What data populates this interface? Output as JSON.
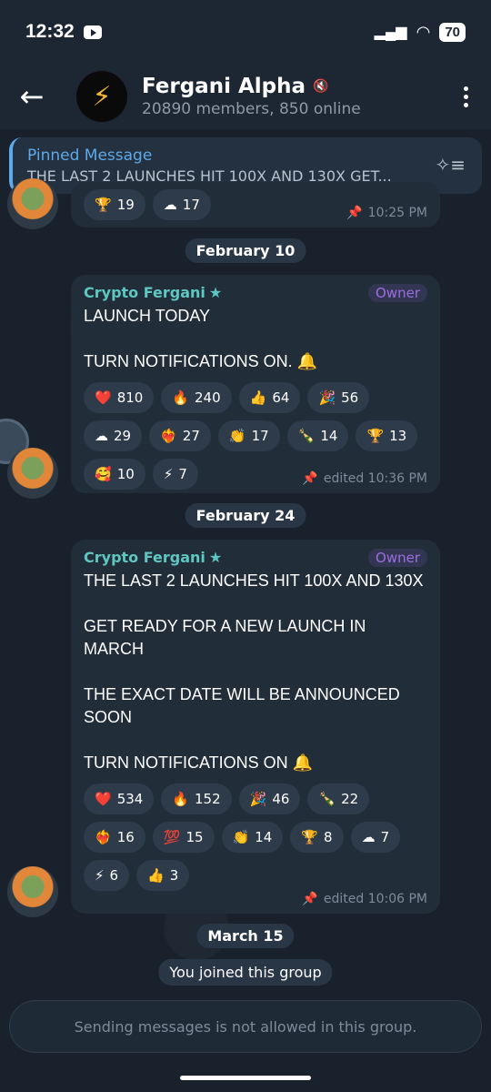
{
  "status": {
    "time": "12:32",
    "battery": "70"
  },
  "header": {
    "title": "Fergani Alpha",
    "subtitle": "20890 members, 850 online",
    "avatar_glyph": "⚡"
  },
  "pinned": {
    "label": "Pinned Message",
    "text": "THE LAST 2 LAUNCHES HIT 100X AND 130X  GET..."
  },
  "top_message": {
    "reactions": [
      {
        "emoji": "🏆",
        "count": "19"
      },
      {
        "emoji": "☁",
        "count": "17"
      }
    ],
    "time": "10:25 PM"
  },
  "date1": "February 10",
  "message1": {
    "sender": "Crypto Fergani",
    "role": "Owner",
    "text_line1": "LAUNCH TODAY",
    "text_line2": "TURN NOTIFICATIONS ON. 🔔",
    "reactions": [
      {
        "emoji": "❤️",
        "count": "810"
      },
      {
        "emoji": "🔥",
        "count": "240"
      },
      {
        "emoji": "👍",
        "count": "64"
      },
      {
        "emoji": "🎉",
        "count": "56"
      },
      {
        "emoji": "☁",
        "count": "29"
      },
      {
        "emoji": "❤️‍🔥",
        "count": "27"
      },
      {
        "emoji": "👏",
        "count": "17"
      },
      {
        "emoji": "🍾",
        "count": "14"
      },
      {
        "emoji": "🏆",
        "count": "13"
      },
      {
        "emoji": "🥰",
        "count": "10"
      },
      {
        "emoji": "⚡",
        "count": "7"
      }
    ],
    "time": "edited 10:36 PM"
  },
  "date2": "February 24",
  "message2": {
    "sender": "Crypto Fergani",
    "role": "Owner",
    "text_line1": "THE LAST 2 LAUNCHES HIT 100X AND 130X",
    "text_line2": "GET READY FOR A NEW LAUNCH IN MARCH",
    "text_line3": "THE EXACT DATE WILL BE ANNOUNCED SOON",
    "text_line4": "TURN NOTIFICATIONS ON 🔔",
    "reactions": [
      {
        "emoji": "❤️",
        "count": "534"
      },
      {
        "emoji": "🔥",
        "count": "152"
      },
      {
        "emoji": "🎉",
        "count": "46"
      },
      {
        "emoji": "🍾",
        "count": "22"
      },
      {
        "emoji": "❤️‍🔥",
        "count": "16"
      },
      {
        "emoji": "💯",
        "count": "15"
      },
      {
        "emoji": "👏",
        "count": "14"
      },
      {
        "emoji": "🏆",
        "count": "8"
      },
      {
        "emoji": "☁",
        "count": "7"
      },
      {
        "emoji": "⚡",
        "count": "6"
      },
      {
        "emoji": "👍",
        "count": "3"
      }
    ],
    "time": "edited 10:06 PM"
  },
  "date3": "March 15",
  "service_message": "You joined this group",
  "bottom_notice": "Sending messages is not allowed in this group."
}
